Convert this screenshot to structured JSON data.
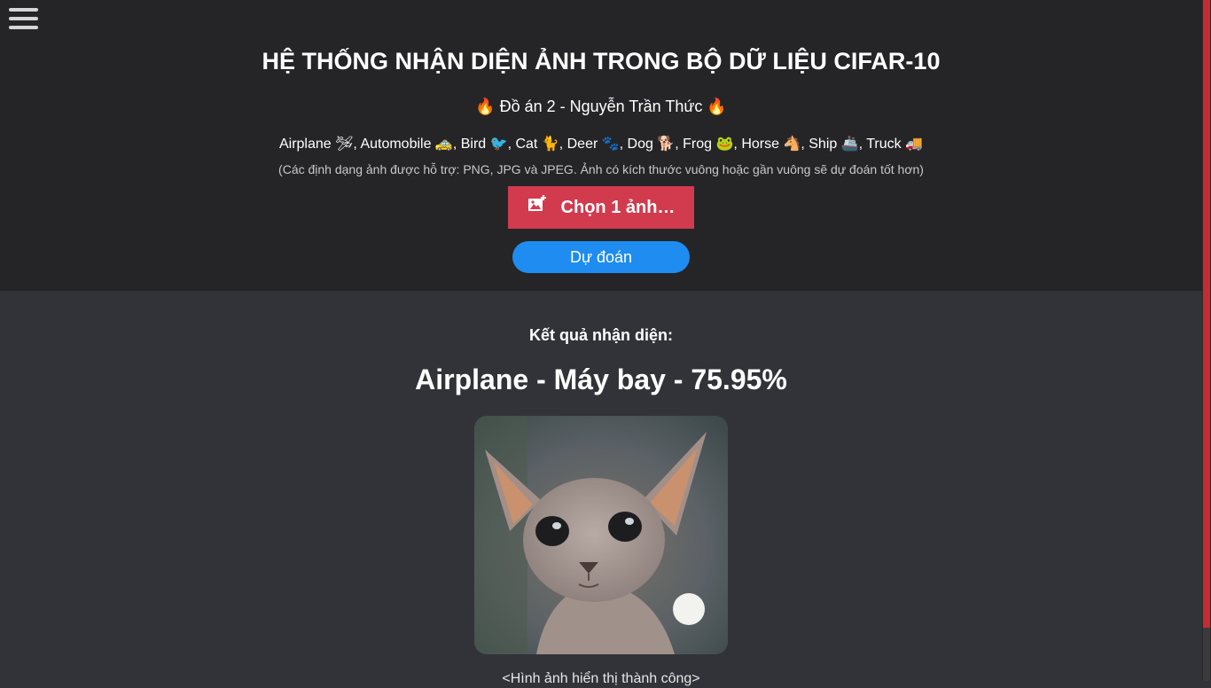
{
  "header": {
    "menu_icon": "hamburger-menu-icon",
    "title": "HỆ THỐNG NHẬN DIỆN ẢNH TRONG BỘ DỮ LIỆU CIFAR-10",
    "subtitle": "🔥 Đồ án 2 - Nguyễn Trần Thức 🔥",
    "classes": "Airplane 🛩, Automobile 🚕, Bird 🐦, Cat 🐈, Deer 🐾, Dog 🐕, Frog 🐸, Horse 🐴, Ship 🚢, Truck 🚚",
    "note": "(Các định dạng ảnh được hỗ trợ: PNG, JPG và JPEG. Ảnh có kích thước vuông hoặc gần vuông sẽ dự đoán tốt hơn)",
    "choose_button": {
      "label": "Chọn 1 ảnh…",
      "icon": "add-image-icon",
      "color": "#d23a4e"
    },
    "predict_button": {
      "label": "Dự đoán",
      "color": "#1e8cf0"
    }
  },
  "result": {
    "label": "Kết quả nhận diện:",
    "value": "Airplane - Máy bay - 75.95%",
    "image": "sphynx-cat-photo",
    "caption": "<Hình ảnh hiển thị thành công>"
  },
  "colors": {
    "header_bg": "#252527",
    "page_bg": "#323338",
    "scroll_thumb": "#c92a32"
  }
}
